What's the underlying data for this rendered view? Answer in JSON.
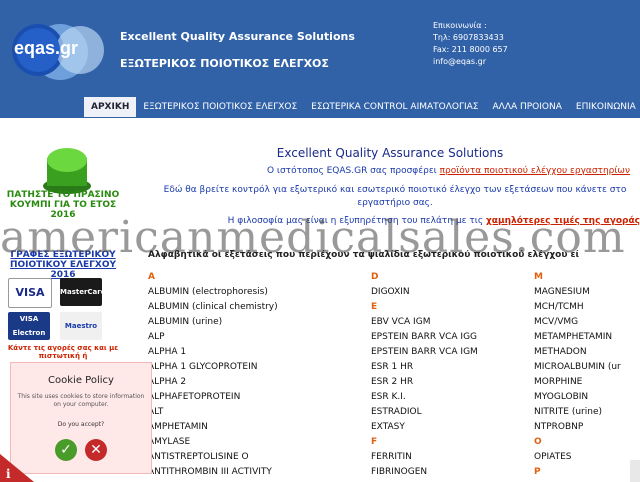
{
  "header": {
    "logo_text": "eqas.gr",
    "logo_tagline": "Excellent Quality Assurance Solutions",
    "title": "Excellent Quality Assurance Solutions",
    "subtitle": "ΕΞΩΤΕΡΙΚΟΣ ΠΟΙΟΤΙΚΟΣ ΕΛΕΓΧΟΣ",
    "contact_label": "Επικοινωνία :",
    "phone": "Τηλ: 6907833433",
    "fax": "Fax: 211 8000 657",
    "email": "info@eqas.gr"
  },
  "nav": {
    "items": [
      {
        "label": "ΑΡΧΙΚΗ"
      },
      {
        "label": "ΕΞΩΤΕΡΙΚΟΣ ΠΟΙΟΤΙΚΟΣ ΕΛΕΓΧΟΣ"
      },
      {
        "label": "ΕΣΩΤΕΡΙΚΑ CONTROL ΑΙΜΑΤΟΛΟΓΙΑΣ"
      },
      {
        "label": "ΑΛΛΑ ΠΡΟΙΟΝΑ"
      },
      {
        "label": "ΕΠΙΚΟΙΝΩΝΙΑ"
      }
    ]
  },
  "sidebar": {
    "green_button_text": "ΠΑΤΗΣΤΕ ΤΟ ΠΡΑΣΙΝΟ ΚΟΥΜΠΙ ΓΙΑ ΤΟ ΕΤΟΣ 2016",
    "forms_link": "ΓΡΑΦΕΣ ΕΞΩΤΕΡΙΚΟΥ ΠΟΙΟΤΙΚΟΥ ΕΛΕΓΧΟΥ 2016",
    "cards": [
      "VISA",
      "MasterCard",
      "VISA Electron",
      "Maestro"
    ],
    "card_note": "Κάντε τις αγορές σας και με πιστωτική ή"
  },
  "main": {
    "heading": "Excellent Quality Assurance Solutions",
    "intro_prefix": "Ο ιστότοπος EQAS.GR σας προσφέρει",
    "intro_link": "προϊόντα ποιοτικού ελέγχου εργαστηρίων",
    "para2": "Εδώ θα βρείτε κοντρόλ για εξωτερικό και εσωτερικό ποιοτικό έλεγχο των εξετάσεων που κάνετε στο εργαστήριο σας.",
    "para3_prefix": "Η φιλοσοφία μας είναι η εξυπηρέτηση του πελάτη με τις",
    "para3_link": "χαμηλότερες τιμές της αγοράς",
    "table_heading": "Αλφαβητικά οι εξετάσεις που περιέχουν τα ψιαλίδια εξωτερικού ποιοτικού ελέγχου εί"
  },
  "watermark": "americanmedicalsales.com",
  "tests": {
    "col1": [
      "A",
      "ALBUMIN (electrophoresis)",
      "ALBUMIN   (clinical chemistry)",
      "ALBUMIN   (urine)",
      "ALP",
      "ALPHA 1",
      "ALPHA 1 GLYCOPROTEIN",
      "ALPHA 2",
      "ALPHAFETOPROTEIN",
      "ALT",
      "AMPHETAMIN",
      "AMYLASE",
      "ANTISTREPTOLISINE O",
      "ANTITHROMBIN III ACTIVITY"
    ],
    "col2": [
      "D",
      "DIGOXIN",
      "E",
      "EBV VCA IGM",
      "EPSTEIN BARR VCA IGG",
      "EPSTEIN BARR VCA IGM",
      "ESR 1 HR",
      "ESR 2 HR",
      "ESR K.I.",
      "ESTRADIOL",
      "EXTASY",
      "F",
      "FERRITIN",
      "FIBRINOGEN"
    ],
    "col3": [
      "M",
      "MAGNESIUM",
      "MCH/TCMH",
      "MCV/VMG",
      "METAMPHETAMIN",
      "METHADON",
      "MICROALBUMIN (ur",
      "MORPHINE",
      "MYOGLOBIN",
      "NITRITE (urine)",
      "NTPROBNP",
      "O",
      "OPIATES",
      "P"
    ]
  },
  "cookie": {
    "title": "Cookie Policy",
    "text": "This site uses cookies to store information on your computer.",
    "question": "Do you accept?",
    "accept": "✓",
    "decline": "✕"
  },
  "colors": {
    "header_bg": "#3162a8",
    "letter": "#e06010",
    "link": "#cc2200"
  }
}
